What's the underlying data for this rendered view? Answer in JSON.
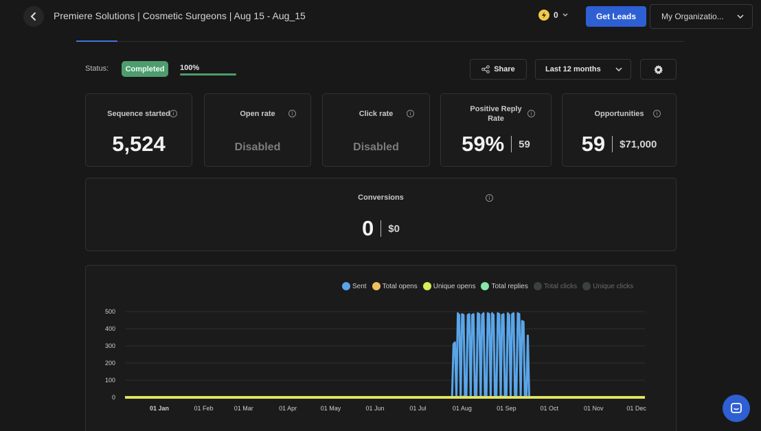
{
  "header": {
    "title": "Premiere Solutions | Cosmetic Surgeons | Aug 15 - Aug_15",
    "credits": "0",
    "get_leads_label": "Get Leads",
    "organization_label": "My Organizatio..."
  },
  "status": {
    "label": "Status:",
    "badge": "Completed",
    "progress_label": "100%",
    "progress": 1.0,
    "share_label": "Share",
    "range_label": "Last 12 months"
  },
  "metrics": {
    "sequence_started": {
      "title": "Sequence started",
      "value": "5,524"
    },
    "open_rate": {
      "title": "Open rate",
      "value": "Disabled"
    },
    "click_rate": {
      "title": "Click rate",
      "value": "Disabled"
    },
    "positive_reply_rate": {
      "title_line1": "Positive Reply",
      "title_line2": "Rate",
      "value": "59%",
      "count": "59"
    },
    "opportunities": {
      "title": "Opportunities",
      "value": "59",
      "amount": "$71,000"
    },
    "conversions": {
      "title": "Conversions",
      "value": "0",
      "amount": "$0"
    }
  },
  "colors": {
    "accent": "#2e5fd3",
    "success": "#4f9c6f",
    "sent": "#5aa5e8",
    "total_opens": "#f0c060",
    "unique_opens": "#d8ec5c",
    "total_replies": "#86e8a8",
    "total_clicks": "#3a4240",
    "unique_clicks": "#3a4240"
  },
  "icons": {
    "back": "chevron-left-icon",
    "credits": "lightning-icon",
    "share": "share-icon",
    "settings": "gear-icon",
    "chat": "chat-icon"
  },
  "chart_data": {
    "type": "line",
    "legend_position": "top-right",
    "legend": [
      {
        "name": "Sent",
        "color": "#5aa5e8",
        "muted": false
      },
      {
        "name": "Total opens",
        "color": "#f0c060",
        "muted": false
      },
      {
        "name": "Unique opens",
        "color": "#d8ec5c",
        "muted": false
      },
      {
        "name": "Total replies",
        "color": "#86e8a8",
        "muted": false
      },
      {
        "name": "Total clicks",
        "color": "#3a4240",
        "muted": true
      },
      {
        "name": "Unique clicks",
        "color": "#3a4240",
        "muted": true
      }
    ],
    "x_ticks": [
      "01 Jan",
      "01 Feb",
      "01 Mar",
      "01 Apr",
      "01 May",
      "01 Jun",
      "01 Jul",
      "01 Aug",
      "01 Sep",
      "01 Oct",
      "01 Nov",
      "01 Dec"
    ],
    "y_ticks": [
      0,
      100,
      200,
      300,
      400,
      500
    ],
    "ylim": [
      0,
      500
    ],
    "grid": true,
    "series": [
      {
        "name": "Sent",
        "points": [
          [
            "2023-01-01",
            0
          ],
          [
            "2023-08-18",
            0
          ],
          [
            "2023-08-19",
            310
          ],
          [
            "2023-08-20",
            320
          ],
          [
            "2023-08-21",
            0
          ],
          [
            "2023-08-22",
            490
          ],
          [
            "2023-08-23",
            480
          ],
          [
            "2023-08-24",
            0
          ],
          [
            "2023-08-25",
            485
          ],
          [
            "2023-08-26",
            480
          ],
          [
            "2023-08-27",
            0
          ],
          [
            "2023-08-28",
            0
          ],
          [
            "2023-08-29",
            480
          ],
          [
            "2023-08-30",
            485
          ],
          [
            "2023-08-31",
            0
          ],
          [
            "2023-09-01",
            480
          ],
          [
            "2023-09-02",
            485
          ],
          [
            "2023-09-03",
            0
          ],
          [
            "2023-09-04",
            0
          ],
          [
            "2023-09-05",
            490
          ],
          [
            "2023-09-06",
            485
          ],
          [
            "2023-09-07",
            0
          ],
          [
            "2023-09-08",
            480
          ],
          [
            "2023-09-09",
            490
          ],
          [
            "2023-09-10",
            0
          ],
          [
            "2023-09-11",
            0
          ],
          [
            "2023-09-12",
            490
          ],
          [
            "2023-09-13",
            485
          ],
          [
            "2023-09-14",
            0
          ],
          [
            "2023-09-15",
            490
          ],
          [
            "2023-09-16",
            480
          ],
          [
            "2023-09-17",
            0
          ],
          [
            "2023-09-18",
            0
          ],
          [
            "2023-09-19",
            490
          ],
          [
            "2023-09-20",
            485
          ],
          [
            "2023-09-21",
            0
          ],
          [
            "2023-09-22",
            480
          ],
          [
            "2023-09-23",
            485
          ],
          [
            "2023-09-24",
            0
          ],
          [
            "2023-09-25",
            0
          ],
          [
            "2023-09-26",
            490
          ],
          [
            "2023-09-27",
            480
          ],
          [
            "2023-09-28",
            0
          ],
          [
            "2023-09-29",
            485
          ],
          [
            "2023-09-30",
            490
          ],
          [
            "2023-10-01",
            0
          ],
          [
            "2023-10-02",
            0
          ],
          [
            "2023-10-03",
            490
          ],
          [
            "2023-10-04",
            485
          ],
          [
            "2023-10-05",
            0
          ],
          [
            "2023-10-06",
            445
          ],
          [
            "2023-10-07",
            440
          ],
          [
            "2023-10-08",
            0
          ],
          [
            "2023-10-09",
            0
          ],
          [
            "2023-10-10",
            360
          ],
          [
            "2023-10-11",
            0
          ],
          [
            "2023-12-31",
            0
          ]
        ]
      },
      {
        "name": "Total opens",
        "points": [
          [
            "2023-01-01",
            0
          ],
          [
            "2023-12-31",
            0
          ]
        ]
      },
      {
        "name": "Unique opens",
        "points": [
          [
            "2023-01-01",
            0
          ],
          [
            "2023-12-31",
            0
          ]
        ]
      },
      {
        "name": "Total replies",
        "points": [
          [
            "2023-01-01",
            0
          ],
          [
            "2023-08-22",
            0
          ],
          [
            "2023-08-26",
            6
          ],
          [
            "2023-09-01",
            0
          ],
          [
            "2023-09-08",
            5
          ],
          [
            "2023-09-15",
            0
          ],
          [
            "2023-09-22",
            6
          ],
          [
            "2023-10-01",
            0
          ],
          [
            "2023-12-31",
            0
          ]
        ]
      }
    ]
  }
}
